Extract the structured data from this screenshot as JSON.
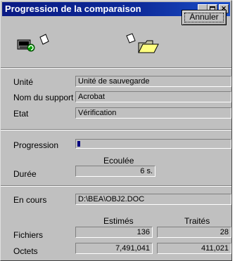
{
  "window": {
    "title": "Progression de la comparaison",
    "controls": {
      "minimize": "minimize-icon",
      "maximize": "maximize-icon",
      "close": "close-icon"
    }
  },
  "toolbar": {
    "cancel_label": "Annuler"
  },
  "icons": {
    "backup": "computer-backup-icon",
    "page_small": "page-icon",
    "folder": "open-folder-icon"
  },
  "info": {
    "unite_label": "Unité",
    "unite_value": "Unité de sauvegarde",
    "support_label": "Nom du support",
    "support_value": "Acrobat",
    "etat_label": "Etat",
    "etat_value": "Vérification"
  },
  "progress": {
    "label": "Progression",
    "fraction": 0.035,
    "elapsed_header": "Ecoulée",
    "duree_label": "Durée",
    "duree_value": "6 s."
  },
  "current": {
    "label": "En cours",
    "value": "D:\\BEA\\OBJ2.DOC"
  },
  "stats": {
    "col_estimated": "Estimés",
    "col_processed": "Traités",
    "fichiers_label": "Fichiers",
    "fichiers_estimated": "136",
    "fichiers_processed": "28",
    "octets_label": "Octets",
    "octets_estimated": "7,491,041",
    "octets_processed": "411,021"
  },
  "colors": {
    "titlebar": "#0a1a84",
    "window": "#c0c0c0",
    "progress": "#00007f"
  }
}
